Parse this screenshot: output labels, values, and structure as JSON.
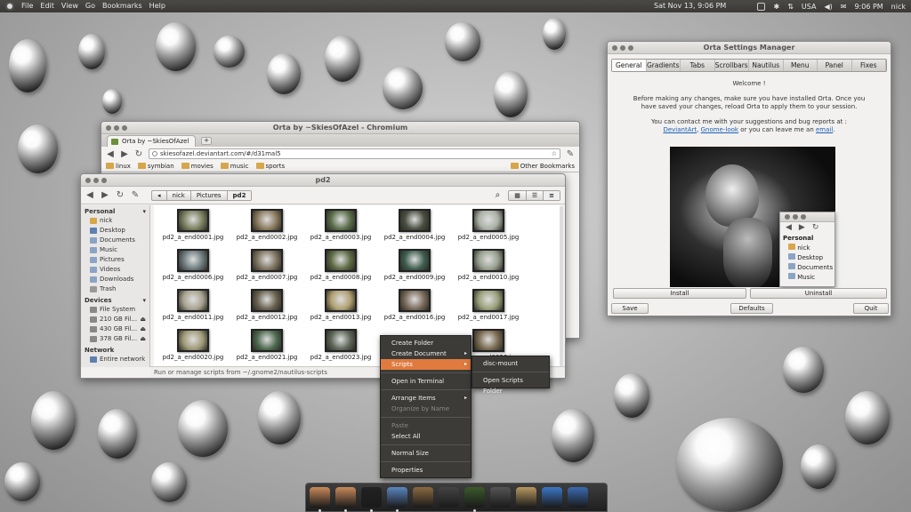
{
  "top_panel": {
    "menus": [
      "File",
      "Edit",
      "View",
      "Go",
      "Bookmarks",
      "Help"
    ],
    "datetime": "Sat Nov 13,  9:06 PM",
    "keyboard": "USA",
    "clock": "9:06 PM",
    "user": "nick"
  },
  "orta": {
    "title": "Orta Settings Manager",
    "tabs": [
      "General",
      "Gradients",
      "Tabs",
      "Scrollbars",
      "Nautilus",
      "Menu",
      "Panel",
      "Fixes"
    ],
    "welcome": "Welcome !",
    "para1": "Before making any changes, make sure you have installed Orta. Once you have saved your changes, reload Orta to apply them to your session.",
    "para2a": "You can contact me with your suggestions and bug reports at :",
    "link1": "DeviantArt",
    "sep1": ",",
    "link2": "Gnome-look",
    "para2b": "or you can leave me an",
    "link3": "email",
    "install": "Install",
    "uninstall": "Uninstall",
    "save": "Save",
    "defaults": "Defaults",
    "quit": "Quit",
    "mini": {
      "personal": "Personal",
      "items": [
        "nick",
        "Desktop",
        "Documents",
        "Music"
      ]
    }
  },
  "chromium": {
    "title": "Orta by ~SkiesOfAzel - Chromium",
    "tab": "Orta by ~SkiesOfAzel",
    "url": "skiesofazel.deviantart.com/#/d31mal5",
    "bookmarks": [
      "linux",
      "symbian",
      "movies",
      "music",
      "sports"
    ],
    "other_bookmarks": "Other Bookmarks"
  },
  "nautilus": {
    "title": "pd2",
    "crumbs": [
      "nick",
      "Pictures",
      "pd2"
    ],
    "personal": "Personal",
    "personal_items": [
      "nick",
      "Desktop",
      "Documents",
      "Music",
      "Pictures",
      "Videos",
      "Downloads",
      "Trash"
    ],
    "devices": "Devices",
    "device_items": [
      "File System",
      "210 GB Fil...",
      "430 GB Fil...",
      "378 GB Fil..."
    ],
    "network": "Network",
    "network_items": [
      "Entire network"
    ],
    "files": [
      "pd2_a_end0001.jpg",
      "pd2_a_end0002.jpg",
      "pd2_a_end0003.jpg",
      "pd2_a_end0004.jpg",
      "pd2_a_end0005.jpg",
      "pd2_a_end0006.jpg",
      "pd2_a_end0007.jpg",
      "pd2_a_end0008.jpg",
      "pd2_a_end0009.jpg",
      "pd2_a_end0010.jpg",
      "pd2_a_end0011.jpg",
      "pd2_a_end0012.jpg",
      "pd2_a_end0013.jpg",
      "pd2_a_end0016.jpg",
      "pd2_a_end0017.jpg",
      "pd2_a_end0020.jpg",
      "pd2_a_end0021.jpg",
      "pd2_a_end0023.jpg",
      "",
      "pd2_a_end0026.jpg"
    ],
    "status": "Run or manage scripts from ~/.gnome2/nautilus-scripts"
  },
  "context_menu": {
    "items": [
      "Create Folder",
      "Create Document",
      "Scripts",
      "Open in Terminal",
      "Arrange Items",
      "Organize by Name",
      "Paste",
      "Select All",
      "Normal Size",
      "Properties"
    ]
  },
  "submenu": {
    "items": [
      "disc-mount",
      "Open Scripts Folder"
    ]
  },
  "dock": {
    "icons": [
      "cat-app-icon",
      "cat-app-icon",
      "terminal-icon",
      "disk-utility-icon",
      "speaker-icon",
      "media-player-icon",
      "system-monitor-icon",
      "suit-icon",
      "package-installer-icon",
      "cursor-app-icon",
      "wrench-settings-icon"
    ]
  }
}
